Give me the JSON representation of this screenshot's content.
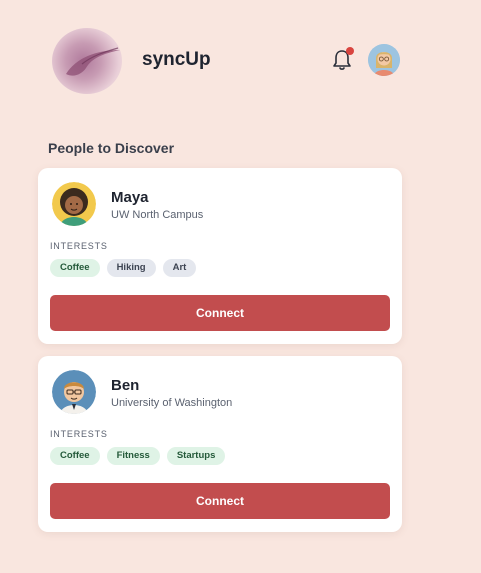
{
  "header": {
    "app_title": "syncUp",
    "notification_icon": "bell-icon",
    "has_notification": true
  },
  "section": {
    "title": "People to Discover"
  },
  "people": [
    {
      "name": "Maya",
      "location": "UW North Campus",
      "interests_label": "INTERESTS",
      "interests": [
        {
          "label": "Coffee",
          "style": "green"
        },
        {
          "label": "Hiking",
          "style": "gray"
        },
        {
          "label": "Art",
          "style": "gray"
        }
      ],
      "button_label": "Connect"
    },
    {
      "name": "Ben",
      "location": "University of Washington",
      "interests_label": "INTERESTS",
      "interests": [
        {
          "label": "Coffee",
          "style": "green"
        },
        {
          "label": "Fitness",
          "style": "green"
        },
        {
          "label": "Startups",
          "style": "green"
        }
      ],
      "button_label": "Connect"
    }
  ],
  "colors": {
    "background": "#f9e6df",
    "accent": "#c24d4e",
    "notification_dot": "#d9443f",
    "tag_green_bg": "#dff3e6",
    "tag_gray_bg": "#e4e7ee"
  }
}
